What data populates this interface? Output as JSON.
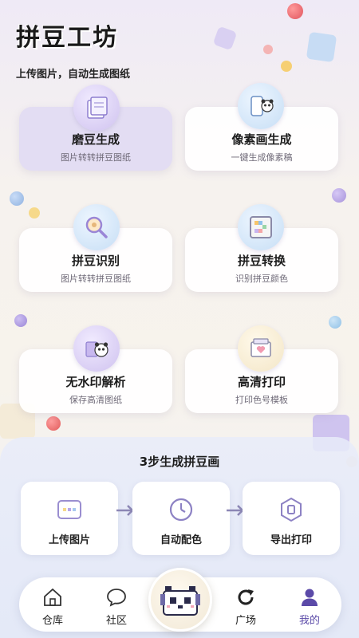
{
  "header": {
    "title": "拼豆工坊",
    "subtitle": "上传图片，自动生成图纸"
  },
  "features": [
    {
      "title": "磨豆生成",
      "subtitle": "图片转转拼豆图纸",
      "icon": "paper-stack-icon"
    },
    {
      "title": "像素画生成",
      "subtitle": "一键生成像素稿",
      "icon": "panda-phone-icon"
    },
    {
      "title": "拼豆识别",
      "subtitle": "图片转转拼豆图纸",
      "icon": "magnifier-icon"
    },
    {
      "title": "拼豆转换",
      "subtitle": "识别拼豆颜色",
      "icon": "pixel-frame-icon"
    },
    {
      "title": "无水印解析",
      "subtitle": "保存高清图纸",
      "icon": "panda-tablet-icon"
    },
    {
      "title": "高清打印",
      "subtitle": "打印色号模板",
      "icon": "printer-icon"
    }
  ],
  "steps": {
    "title": "3步生成拼豆画",
    "items": [
      {
        "label": "上传图片",
        "icon": "image-upload-icon"
      },
      {
        "label": "自动配色",
        "icon": "clock-icon"
      },
      {
        "label": "导出打印",
        "icon": "export-icon"
      }
    ]
  },
  "tabbar": {
    "items": [
      {
        "label": "仓库",
        "icon": "home-icon"
      },
      {
        "label": "社区",
        "icon": "chat-icon"
      },
      {
        "label": "广场",
        "icon": "refresh-icon"
      },
      {
        "label": "我的",
        "icon": "user-icon"
      }
    ],
    "center_icon": "panda-logo-icon",
    "active_color": "#5b4aa8"
  },
  "colors": {
    "accent": "#5b4aa8",
    "card_active": "#e3ddf3"
  }
}
